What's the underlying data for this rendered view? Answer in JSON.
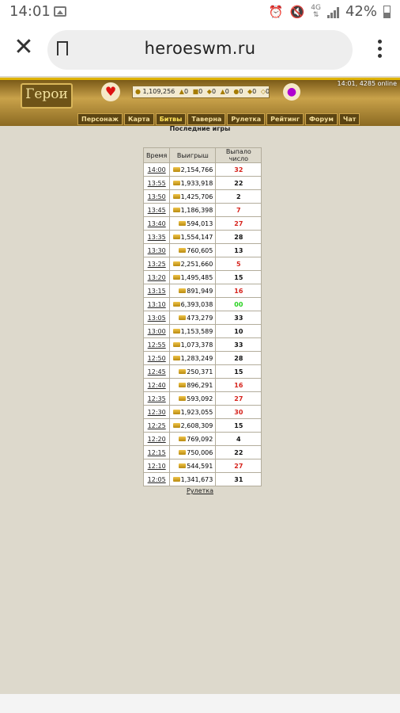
{
  "status_bar": {
    "time": "14:01",
    "network": "4G",
    "battery": "42%"
  },
  "browser": {
    "url": "heroeswm.ru"
  },
  "game_header": {
    "logo_text": "Герои",
    "online": "14:01, 4285 online",
    "resources": [
      "1,109,256",
      "0",
      "0",
      "0",
      "0",
      "0",
      "0",
      "0"
    ],
    "menu": [
      "Персонаж",
      "Карта",
      "Битвы",
      "Таверна",
      "Рулетка",
      "Рейтинг",
      "Форум",
      "Чат"
    ]
  },
  "page": {
    "title": "Последние игры",
    "columns": [
      "Время",
      "Выигрыш",
      "Выпало число"
    ],
    "rows": [
      {
        "time": "14:00",
        "win": "2,154,766",
        "num": "32",
        "color": "red"
      },
      {
        "time": "13:55",
        "win": "1,933,918",
        "num": "22",
        "color": "black"
      },
      {
        "time": "13:50",
        "win": "1,425,706",
        "num": "2",
        "color": "black"
      },
      {
        "time": "13:45",
        "win": "1,186,398",
        "num": "7",
        "color": "red"
      },
      {
        "time": "13:40",
        "win": "594,013",
        "num": "27",
        "color": "red"
      },
      {
        "time": "13:35",
        "win": "1,554,147",
        "num": "28",
        "color": "black"
      },
      {
        "time": "13:30",
        "win": "760,605",
        "num": "13",
        "color": "black"
      },
      {
        "time": "13:25",
        "win": "2,251,660",
        "num": "5",
        "color": "red"
      },
      {
        "time": "13:20",
        "win": "1,495,485",
        "num": "15",
        "color": "black"
      },
      {
        "time": "13:15",
        "win": "891,949",
        "num": "16",
        "color": "red"
      },
      {
        "time": "13:10",
        "win": "6,393,038",
        "num": "00",
        "color": "green"
      },
      {
        "time": "13:05",
        "win": "473,279",
        "num": "33",
        "color": "black"
      },
      {
        "time": "13:00",
        "win": "1,153,589",
        "num": "10",
        "color": "black"
      },
      {
        "time": "12:55",
        "win": "1,073,378",
        "num": "33",
        "color": "black"
      },
      {
        "time": "12:50",
        "win": "1,283,249",
        "num": "28",
        "color": "black"
      },
      {
        "time": "12:45",
        "win": "250,371",
        "num": "15",
        "color": "black"
      },
      {
        "time": "12:40",
        "win": "896,291",
        "num": "16",
        "color": "red"
      },
      {
        "time": "12:35",
        "win": "593,092",
        "num": "27",
        "color": "red"
      },
      {
        "time": "12:30",
        "win": "1,923,055",
        "num": "30",
        "color": "red"
      },
      {
        "time": "12:25",
        "win": "2,608,309",
        "num": "15",
        "color": "black"
      },
      {
        "time": "12:20",
        "win": "769,092",
        "num": "4",
        "color": "black"
      },
      {
        "time": "12:15",
        "win": "750,006",
        "num": "22",
        "color": "black"
      },
      {
        "time": "12:10",
        "win": "544,591",
        "num": "27",
        "color": "red"
      },
      {
        "time": "12:05",
        "win": "1,341,673",
        "num": "31",
        "color": "black"
      }
    ],
    "footer_link": "Рулетка"
  },
  "colors": {
    "red": "#d6231c",
    "black": "#111111",
    "green": "#27d11f"
  }
}
